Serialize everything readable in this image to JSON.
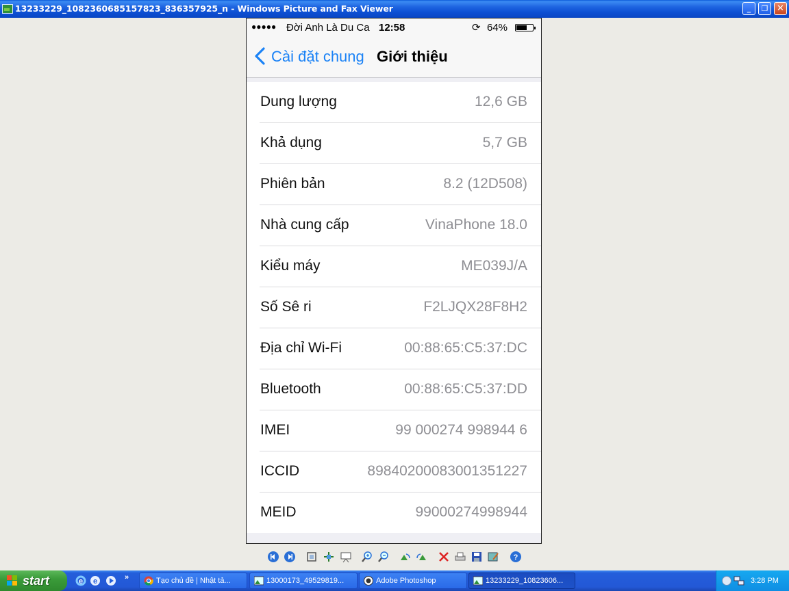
{
  "window": {
    "title": "13233229_1082360685157823_836357925_n - Windows Picture and Fax Viewer",
    "controls": [
      "minimize-icon",
      "restore-icon",
      "close-icon"
    ]
  },
  "phone": {
    "status_bar": {
      "signal": "●●●●●",
      "carrier": "Đời Anh Là Du Ca",
      "time": "12:58",
      "battery_percent": "64%",
      "battery_level": 0.64
    },
    "nav": {
      "back_label": "Cài đặt chung",
      "title": "Giới thiệu"
    },
    "rows": [
      {
        "label": "Dung lượng",
        "value": "12,6 GB"
      },
      {
        "label": "Khả dụng",
        "value": "5,7 GB"
      },
      {
        "label": "Phiên bản",
        "value": "8.2 (12D508)"
      },
      {
        "label": "Nhà cung cấp",
        "value": "VinaPhone 18.0"
      },
      {
        "label": "Kiểu máy",
        "value": "ME039J/A"
      },
      {
        "label": "Số Sê ri",
        "value": "F2LJQX28F8H2"
      },
      {
        "label": "Địa chỉ Wi-Fi",
        "value": "00:88:65:C5:37:DC"
      },
      {
        "label": "Bluetooth",
        "value": "00:88:65:C5:37:DD"
      },
      {
        "label": "IMEI",
        "value": "99 000274 998944 6"
      },
      {
        "label": "ICCID",
        "value": "89840200083001351227"
      },
      {
        "label": "MEID",
        "value": "99000274998944"
      }
    ],
    "colors": {
      "ios_blue": "#1a82f6",
      "value_gray": "#8e8e93"
    }
  },
  "viewer_toolbar": {
    "buttons": [
      "previous-image-icon",
      "next-image-icon",
      "best-fit-icon",
      "actual-size-icon",
      "slideshow-icon",
      "zoom-in-icon",
      "zoom-out-icon",
      "rotate-clockwise-icon",
      "rotate-counterclockwise-icon",
      "delete-icon",
      "print-icon",
      "save-icon",
      "edit-icon",
      "help-icon"
    ]
  },
  "taskbar": {
    "start_label": "start",
    "chevron": "»",
    "tasks": [
      {
        "label": "Tạo chủ đề | Nhật tả..."
      },
      {
        "label": "13000173_49529819..."
      },
      {
        "label": "Adobe Photoshop"
      },
      {
        "label": "13233229_10823606..."
      }
    ],
    "clock": "3:28 PM"
  }
}
